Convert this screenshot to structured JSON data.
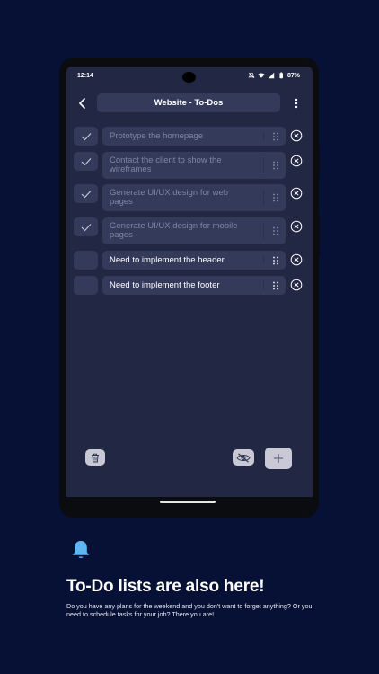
{
  "status_bar": {
    "time": "12:14",
    "battery": "87%"
  },
  "header": {
    "title": "Website - To-Dos"
  },
  "todos": [
    {
      "text": "Prototype the homepage",
      "done": true
    },
    {
      "text": "Contact the client to show the wireframes",
      "done": true
    },
    {
      "text": "Generate UI/UX design for web pages",
      "done": true
    },
    {
      "text": "Generate UI/UX design for mobile pages",
      "done": true
    },
    {
      "text": "Need to implement the header",
      "done": false
    },
    {
      "text": "Need to implement the footer",
      "done": false
    }
  ],
  "promo": {
    "headline": "To-Do lists are also here!",
    "description": "Do you have any plans for the weekend and you don't want to forget anything? Or you need to schedule tasks for your job? There you are!"
  },
  "colors": {
    "page_bg": "#071135",
    "screen_bg": "#222844",
    "row_bg": "#343b5a",
    "bell": "#5fb6f5"
  },
  "icons": {
    "back": "chevron-left-icon",
    "more": "more-vertical-icon",
    "check": "check-icon",
    "drag": "drag-handle-icon",
    "remove": "close-circle-icon",
    "delete": "trash-icon",
    "hide": "eye-off-icon",
    "add": "plus-icon",
    "bell": "bell-icon"
  }
}
